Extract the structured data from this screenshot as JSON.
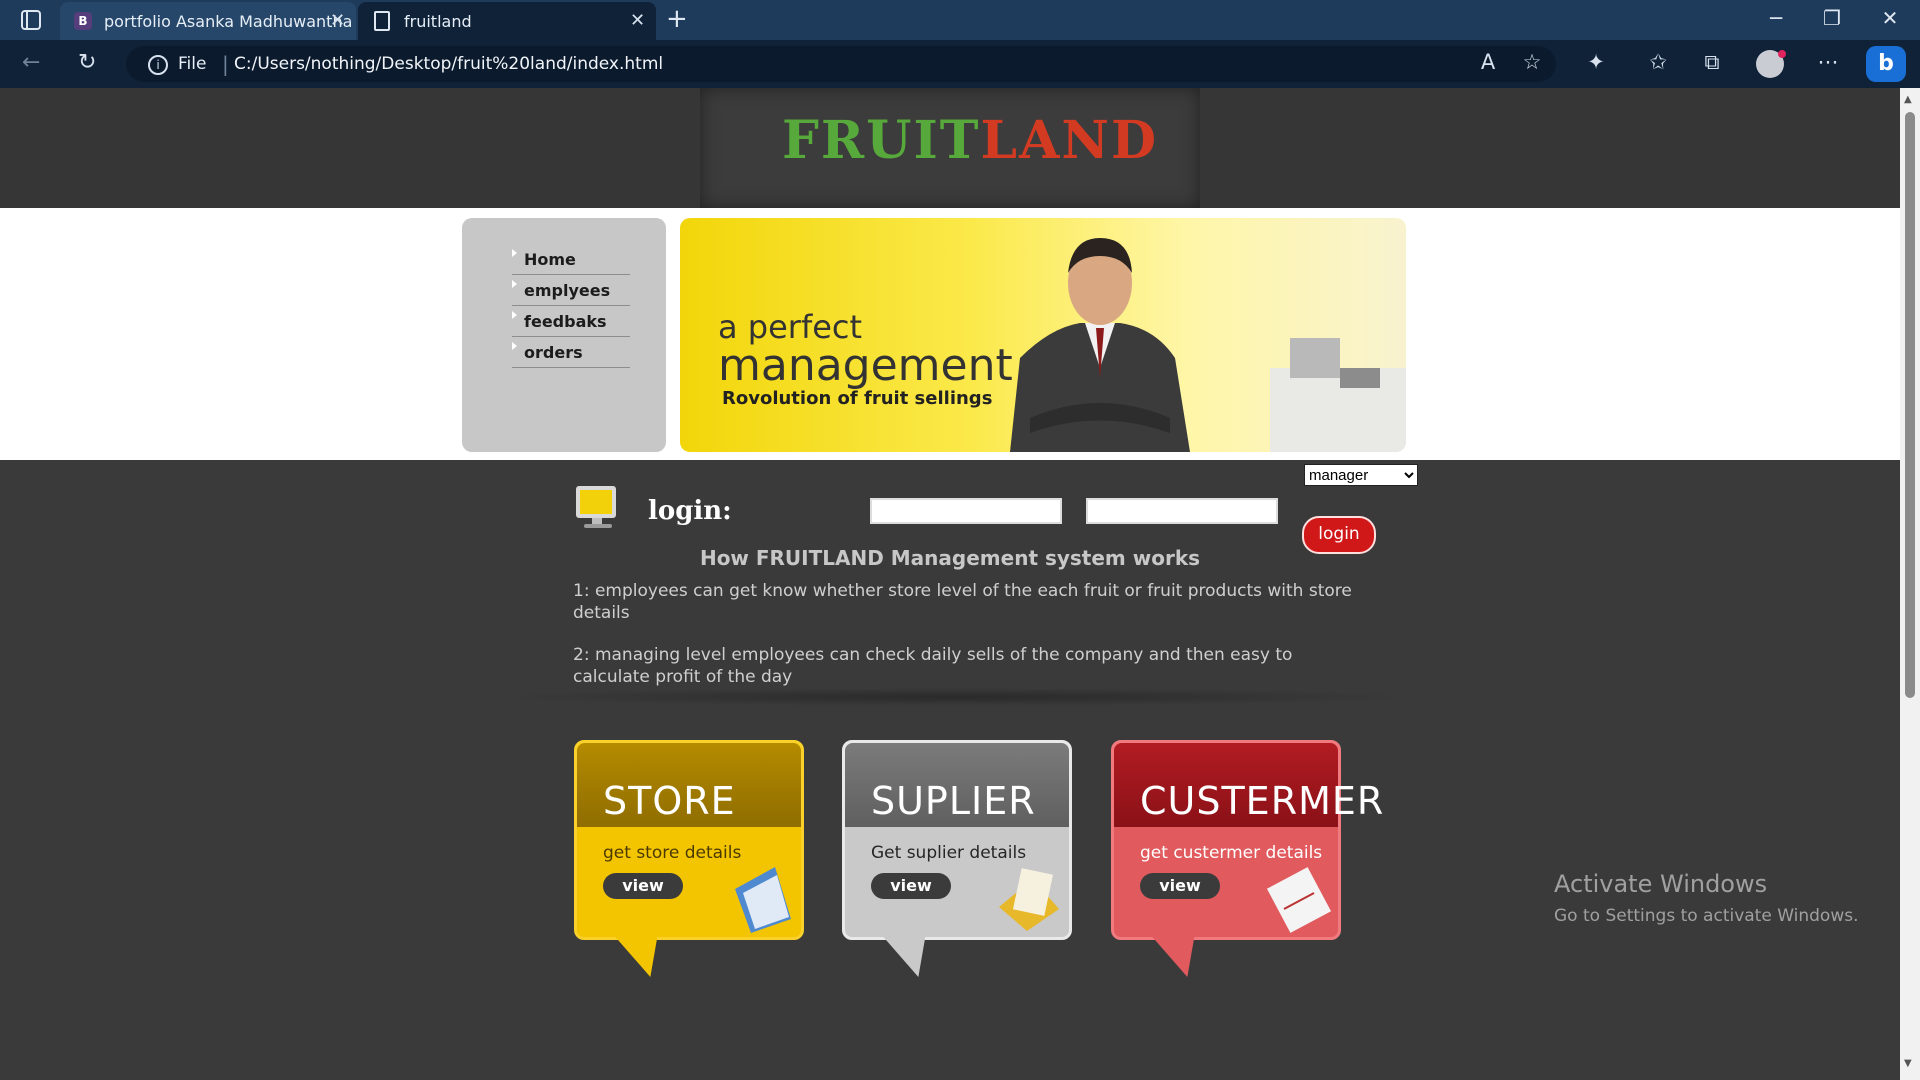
{
  "browser": {
    "tabs": [
      {
        "favicon": "B",
        "title": "portfolio Asanka Madhuwantha",
        "close": "✕"
      },
      {
        "favicon": "document-icon",
        "title": "fruitland",
        "close": "✕"
      }
    ],
    "new_tab": "+",
    "address": {
      "scheme_label": "File",
      "url": "C:/Users/nothing/Desktop/fruit%20land/index.html"
    },
    "window_controls": [
      "─",
      "❐",
      "✕"
    ],
    "toolbar_icons": [
      "read-aloud-icon",
      "add-favorite-icon",
      "extensions-icon",
      "favorites-icon",
      "collections-icon",
      "profile-icon",
      "more-icon",
      "bing-icon"
    ]
  },
  "site": {
    "logo": {
      "part1": "FRUIT",
      "part2": "LAND",
      "color_green": "#56a93a",
      "color_red": "#d23a22"
    },
    "menu": [
      {
        "label": "Home"
      },
      {
        "label": "emplyees"
      },
      {
        "label": "feedbaks"
      },
      {
        "label": "orders"
      }
    ],
    "banner": {
      "line1": "a perfect",
      "line2": "management",
      "tagline": "Rovolution of fruit sellings"
    },
    "login": {
      "label": "login:",
      "role_selected": "manager",
      "username_value": "",
      "password_value": "",
      "button": "login"
    },
    "info": {
      "title": "How FRUITLAND Management system works",
      "items": [
        "1: employees can get know whether store level of the each fruit or fruit products with store details",
        "2: managing level employees can check daily sells of the company and then easy to calculate profit of the day"
      ]
    },
    "cards": [
      {
        "title": "STORE",
        "desc": "get store details",
        "button": "view",
        "color": "#f3c400"
      },
      {
        "title": "SUPLIER",
        "desc": "Get suplier details",
        "button": "view",
        "color": "#c9c9c9"
      },
      {
        "title": "CUSTERMER",
        "desc": "get custermer details",
        "button": "view",
        "color": "#e05a5e"
      }
    ]
  },
  "watermark": {
    "line1": "Activate Windows",
    "line2": "Go to Settings to activate Windows."
  }
}
